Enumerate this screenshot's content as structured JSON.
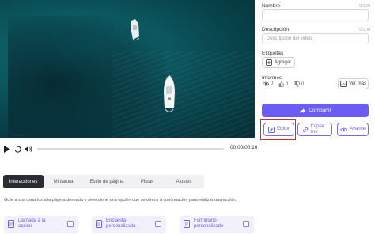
{
  "player": {
    "timecode": "00:00/00:16",
    "progress": 0
  },
  "panel": {
    "name_label": "Nombre",
    "name_count": "0/100",
    "name_value": "",
    "description_label": "Descripción",
    "description_count": "0/200",
    "description_placeholder": "Descripción del video",
    "tags_label": "Etiquetas",
    "add_tag_label": "Agregar",
    "reports_label": "Informes",
    "stats": [
      "0",
      "0",
      "0"
    ],
    "see_more_label": "Ver más",
    "share_label": "Compartir",
    "editor_label": "Editor",
    "copy_link_label": "Copiar link",
    "advanced_label": "Avance"
  },
  "tabs": [
    "Interacciones",
    "Miniatura",
    "Estilo de página",
    "Pistas",
    "Ajustes"
  ],
  "guide_text": "Guíe a sus usuarios a la página deseada o seleccione una opción que se ofrece a continuación para realizar una acción.",
  "cards": [
    {
      "line1": "Llamada a la",
      "line2": "acción"
    },
    {
      "line1": "Encuesta",
      "line2": "personalizada"
    },
    {
      "line1": "Formulario",
      "line2": "personalizado"
    }
  ],
  "colors": {
    "accent": "#6b5cf6",
    "highlight": "#d42a2a",
    "active_tab": "#2b2b33"
  }
}
